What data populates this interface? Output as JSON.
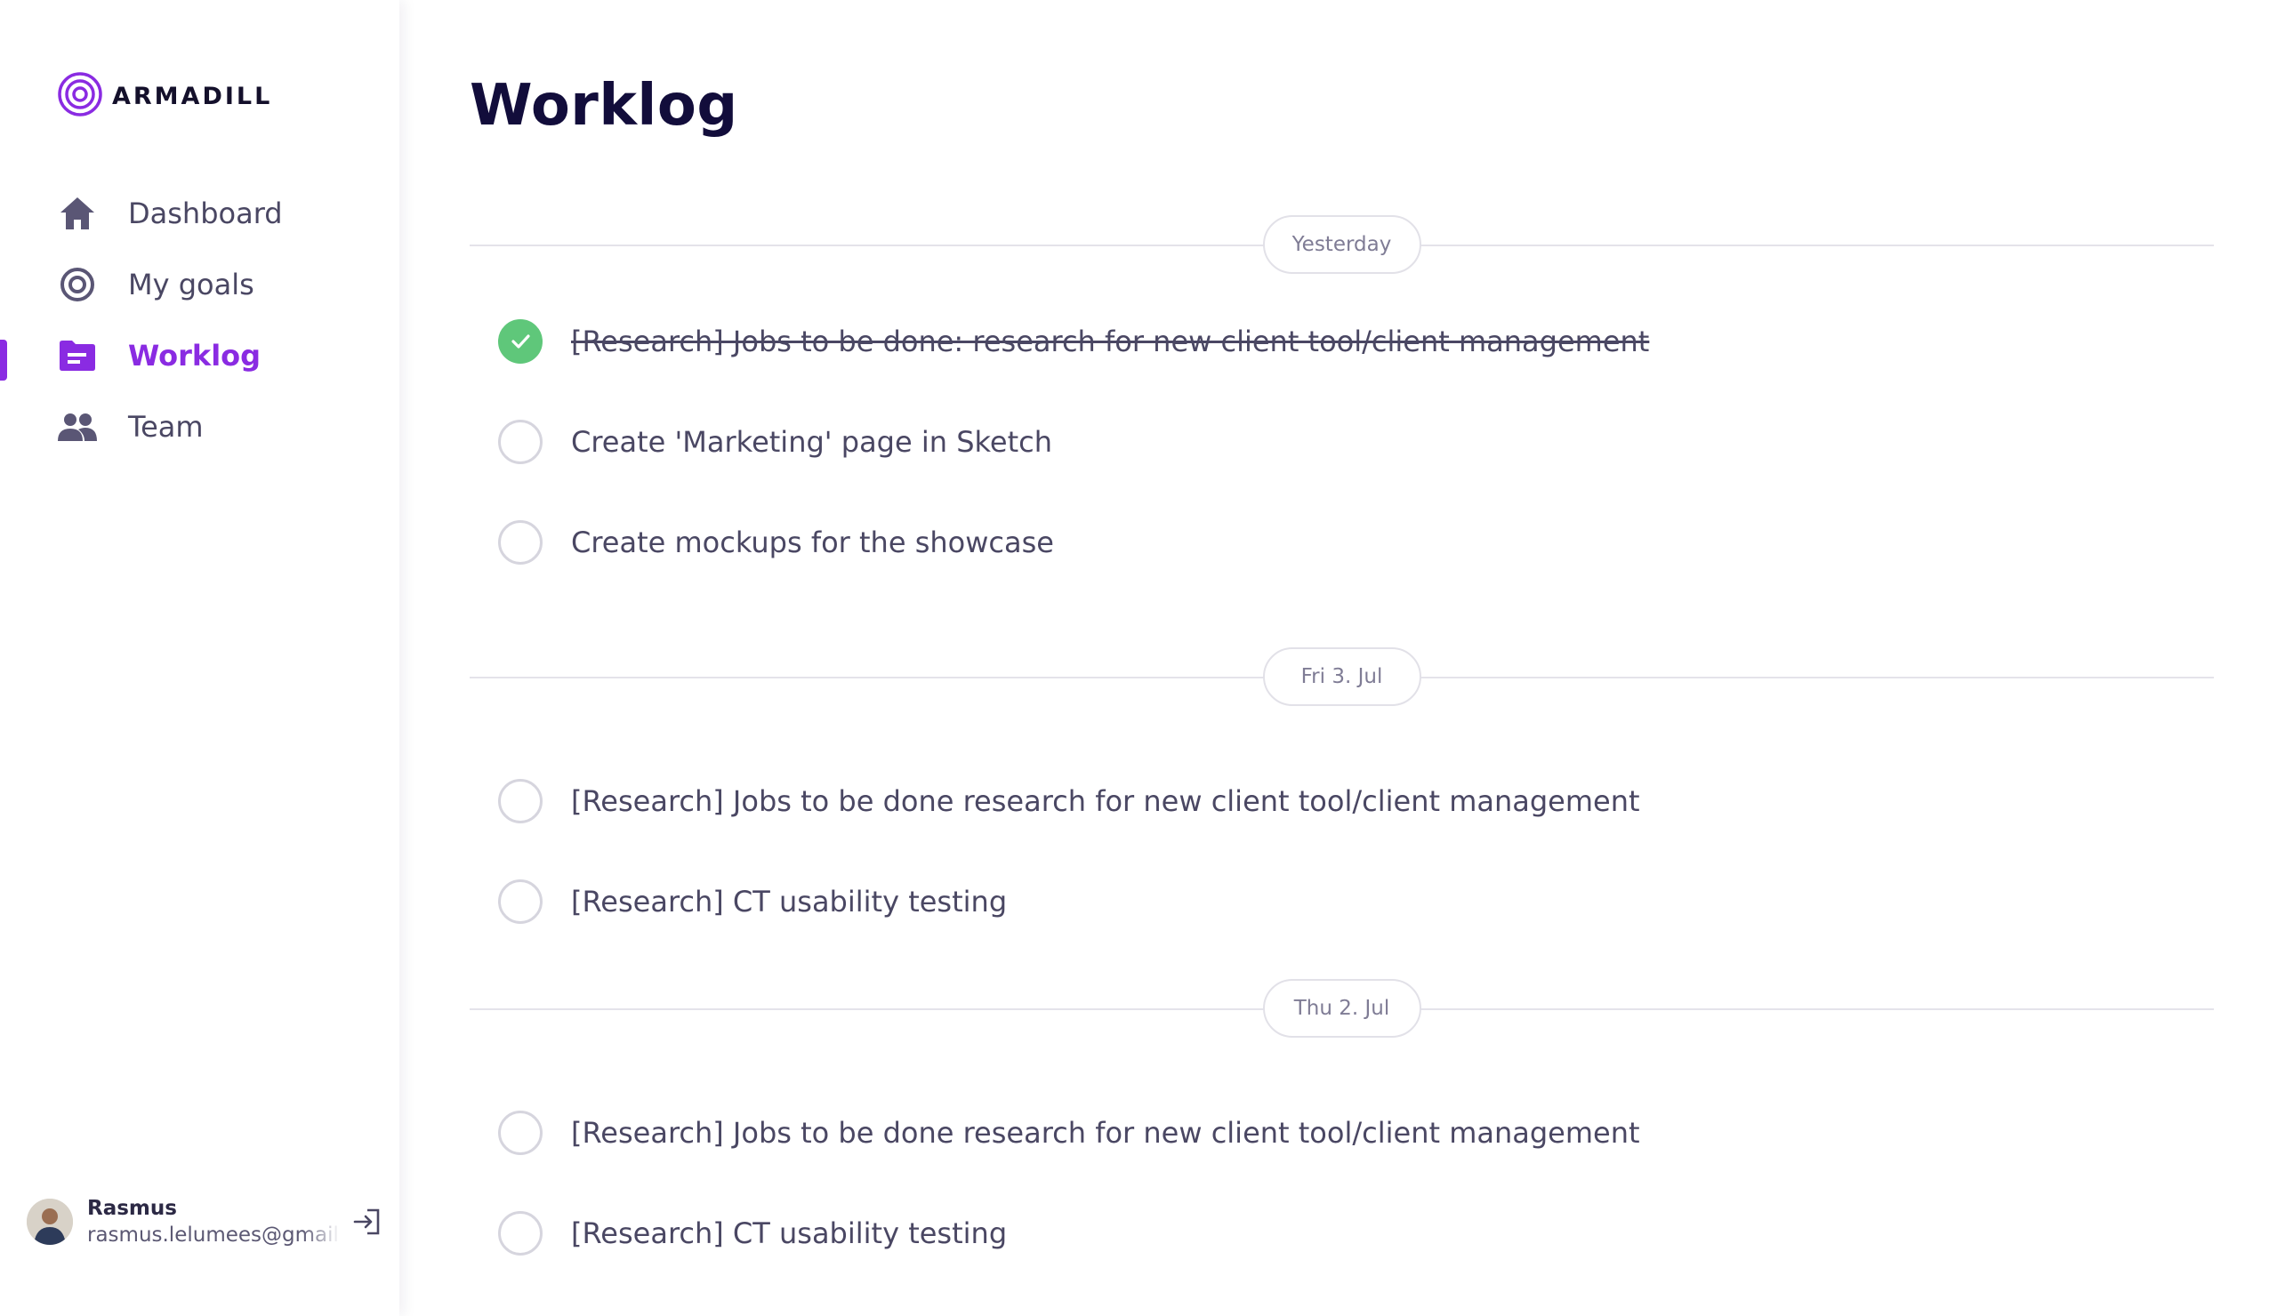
{
  "brand": {
    "name": "ARMADILL",
    "accent": "#8a2be2"
  },
  "sidebar": {
    "items": [
      {
        "label": "Dashboard",
        "icon": "home-icon",
        "active": false
      },
      {
        "label": "My goals",
        "icon": "target-icon",
        "active": false
      },
      {
        "label": "Worklog",
        "icon": "folder-icon",
        "active": true
      },
      {
        "label": "Team",
        "icon": "people-icon",
        "active": false
      }
    ]
  },
  "user": {
    "name": "Rasmus",
    "email": "rasmus.lelumees@gmail.com",
    "logout_icon": "logout-icon"
  },
  "page": {
    "title": "Worklog"
  },
  "groups": [
    {
      "date": "Yesterday",
      "tasks": [
        {
          "text": "[Research] Jobs to be done: research for new client tool/client management",
          "done": true
        },
        {
          "text": "Create 'Marketing' page in Sketch",
          "done": false
        },
        {
          "text": "Create mockups for the showcase",
          "done": false
        }
      ]
    },
    {
      "date": "Fri 3. Jul",
      "tasks": [
        {
          "text": "[Research] Jobs to be done research for new client tool/client management",
          "done": false
        },
        {
          "text": "[Research] CT usability testing",
          "done": false
        }
      ]
    },
    {
      "date": "Thu 2. Jul",
      "tasks": [
        {
          "text": "[Research] Jobs to be done research for new client tool/client management",
          "done": false
        },
        {
          "text": "[Research] CT usability testing",
          "done": false
        }
      ]
    }
  ],
  "colors": {
    "check_done": "#5fc77a",
    "title": "#120d3b",
    "text": "#4a4763"
  }
}
